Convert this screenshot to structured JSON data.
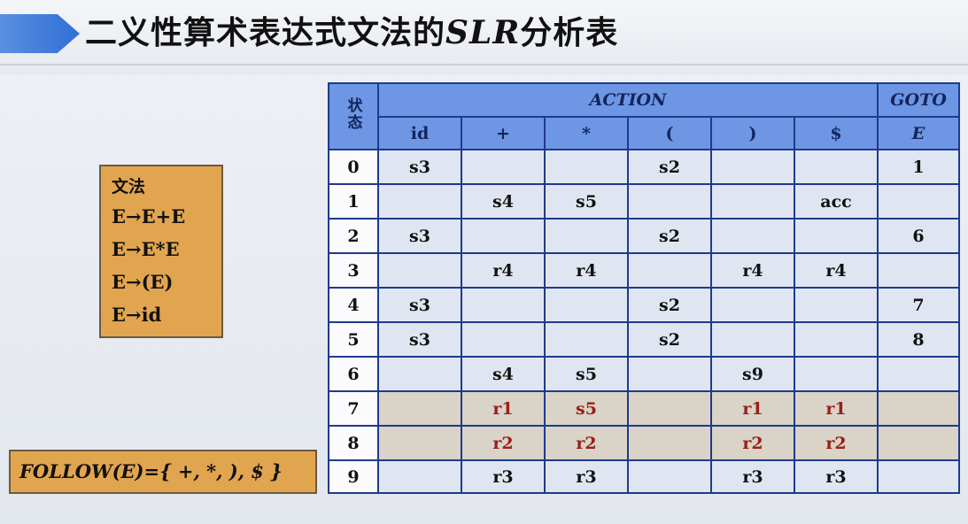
{
  "title": {
    "prefix": "二义性算术表达式文法的",
    "slr": "SLR",
    "suffix": "分析表"
  },
  "grammar": {
    "heading": "文法",
    "rules": [
      "E→E+E",
      "E→E*E",
      "E→(E)",
      "E→id"
    ]
  },
  "follow": "FOLLOW(E)={ +, *, ), $ }",
  "table": {
    "state_header": "状态",
    "action_header": "ACTION",
    "goto_header": "GOTO",
    "action_columns": [
      "id",
      "+",
      "*",
      "(",
      ")",
      "$"
    ],
    "goto_columns": [
      "E"
    ],
    "rows": [
      {
        "state": "0",
        "action": [
          "s3",
          "",
          "",
          "s2",
          "",
          ""
        ],
        "goto": [
          "1"
        ]
      },
      {
        "state": "1",
        "action": [
          "",
          "s4",
          "s5",
          "",
          "",
          "acc"
        ],
        "goto": [
          ""
        ]
      },
      {
        "state": "2",
        "action": [
          "s3",
          "",
          "",
          "s2",
          "",
          ""
        ],
        "goto": [
          "6"
        ]
      },
      {
        "state": "3",
        "action": [
          "",
          "r4",
          "r4",
          "",
          "r4",
          "r4"
        ],
        "goto": [
          ""
        ]
      },
      {
        "state": "4",
        "action": [
          "s3",
          "",
          "",
          "s2",
          "",
          ""
        ],
        "goto": [
          "7"
        ]
      },
      {
        "state": "5",
        "action": [
          "s3",
          "",
          "",
          "s2",
          "",
          ""
        ],
        "goto": [
          "8"
        ]
      },
      {
        "state": "6",
        "action": [
          "",
          "s4",
          "s5",
          "",
          "s9",
          ""
        ],
        "goto": [
          ""
        ]
      },
      {
        "state": "7",
        "action": [
          "",
          "r1",
          "s5",
          "",
          "r1",
          "r1"
        ],
        "goto": [
          ""
        ],
        "highlight": true
      },
      {
        "state": "8",
        "action": [
          "",
          "r2",
          "r2",
          "",
          "r2",
          "r2"
        ],
        "goto": [
          ""
        ],
        "highlight": true
      },
      {
        "state": "9",
        "action": [
          "",
          "r3",
          "r3",
          "",
          "r3",
          "r3"
        ],
        "goto": [
          ""
        ]
      }
    ]
  },
  "colors": {
    "header_blue": "#6d96e4",
    "cell_blue": "#dfe6f1",
    "highlight_row": "#d9d3c8",
    "box_orange": "#e2a54f",
    "reduce_red": "#9b1f16"
  }
}
